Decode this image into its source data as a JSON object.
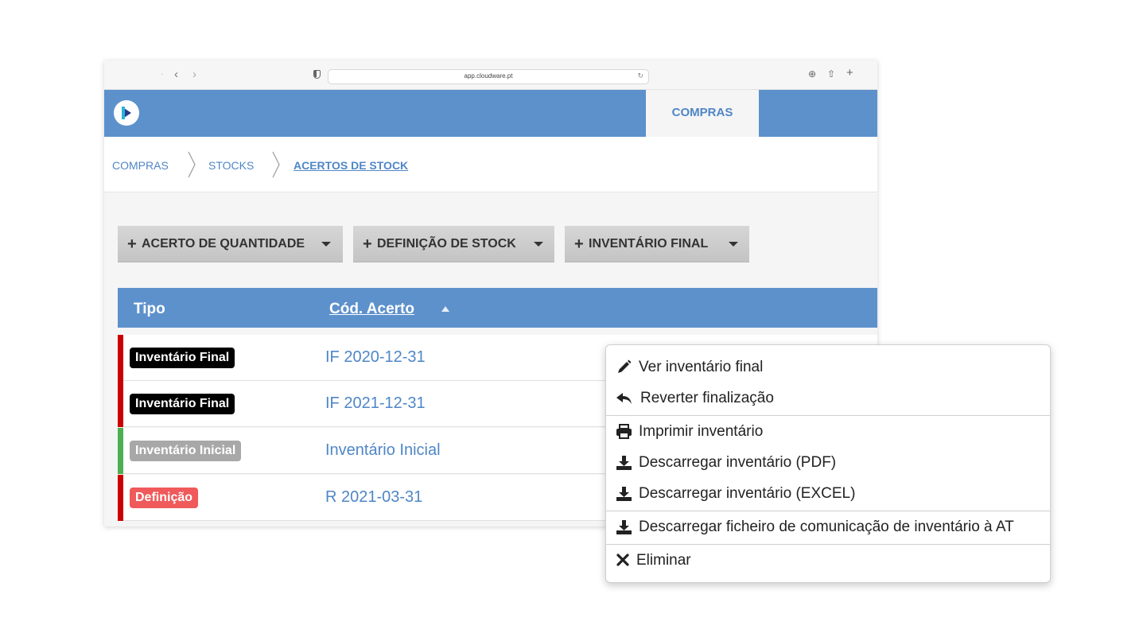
{
  "browser": {
    "address": "app.cloudware.pt"
  },
  "header": {
    "active_tab": "COMPRAS"
  },
  "breadcrumb": {
    "items": [
      "COMPRAS",
      "STOCKS"
    ],
    "current": "ACERTOS DE STOCK"
  },
  "actions": [
    {
      "label": "ACERTO DE QUANTIDADE"
    },
    {
      "label": "DEFINIÇÃO DE STOCK"
    },
    {
      "label": "INVENTÁRIO FINAL"
    }
  ],
  "table": {
    "columns": {
      "type": "Tipo",
      "code": "Cód. Acerto"
    },
    "rows": [
      {
        "type": "Inventário Final",
        "code": "IF 2020-12-31",
        "badge_color": "#000000",
        "bar_color": "#cc0000"
      },
      {
        "type": "Inventário Final",
        "code": "IF 2021-12-31",
        "badge_color": "#000000",
        "bar_color": "#cc0000"
      },
      {
        "type": "Inventário Inicial",
        "code": "Inventário Inicial",
        "badge_color": "#a8a8a8",
        "bar_color": "#4caf50"
      },
      {
        "type": "Definição",
        "code": "R 2021-03-31",
        "badge_color": "#f05a5a",
        "bar_color": "#cc0000"
      }
    ]
  },
  "context_menu": {
    "items": [
      {
        "label": "Ver inventário final",
        "icon": "pencil-icon"
      },
      {
        "label": "Reverter finalização",
        "icon": "undo-arrow-icon"
      },
      {
        "label": "Imprimir inventário",
        "icon": "printer-icon"
      },
      {
        "label": "Descarregar inventário (PDF)",
        "icon": "download-icon"
      },
      {
        "label": "Descarregar inventário (EXCEL)",
        "icon": "download-icon"
      },
      {
        "label": "Descarregar ficheiro de comunicação de inventário à AT",
        "icon": "download-icon"
      },
      {
        "label": "Eliminar",
        "icon": "close-icon"
      }
    ]
  },
  "colors": {
    "header_blue": "#5d91cc",
    "link_blue": "#4f86c6"
  }
}
